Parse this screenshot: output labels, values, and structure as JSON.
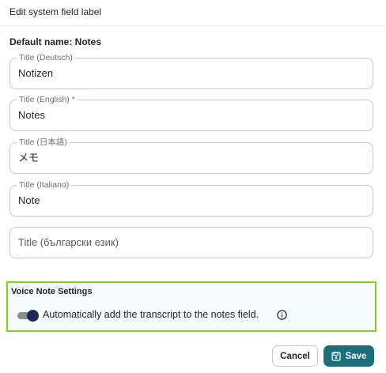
{
  "dialog": {
    "title": "Edit system field label",
    "default_name": "Default name: Notes"
  },
  "fields": [
    {
      "label": "Title (Deutsch)",
      "value": "Notizen",
      "placeholder": ""
    },
    {
      "label": "Title (English) *",
      "value": "Notes",
      "placeholder": ""
    },
    {
      "label": "Title (日本語)",
      "value": "メモ",
      "placeholder": ""
    },
    {
      "label": "Title (Italiano)",
      "value": "Note",
      "placeholder": ""
    },
    {
      "label": "",
      "value": "",
      "placeholder": "Title (български език)"
    }
  ],
  "voice_settings": {
    "title": "Voice Note Settings",
    "toggle_label": "Automatically add the transcript to the notes field.",
    "toggle_on": true,
    "info_icon": "info-icon"
  },
  "footer": {
    "cancel_label": "Cancel",
    "save_label": "Save",
    "save_icon": "save-icon"
  },
  "colors": {
    "accent": "#1c6f7a",
    "highlight_border": "#7ed321",
    "toggle_knob": "#1d2a55"
  }
}
